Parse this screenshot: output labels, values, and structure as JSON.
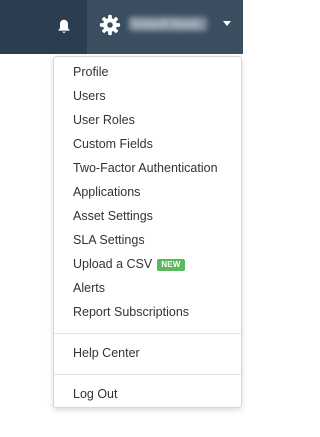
{
  "header": {
    "bell_icon": "bell-icon",
    "gear_icon": "gear-icon",
    "username": "Tinkerff Bank",
    "caret_icon": "caret-down-icon"
  },
  "menu": {
    "items": [
      {
        "label": "Profile"
      },
      {
        "label": "Users"
      },
      {
        "label": "User Roles"
      },
      {
        "label": "Custom Fields"
      },
      {
        "label": "Two-Factor Authentication"
      },
      {
        "label": "Applications"
      },
      {
        "label": "Asset Settings"
      },
      {
        "label": "SLA Settings"
      },
      {
        "label": "Upload a CSV",
        "badge": "NEW"
      },
      {
        "label": "Alerts"
      },
      {
        "label": "Report Subscriptions"
      }
    ],
    "help_label": "Help Center",
    "logout_label": "Log Out"
  },
  "colors": {
    "topbar": "#2b3e4f",
    "user_button": "#3a4e60",
    "badge": "#5cb85c"
  }
}
